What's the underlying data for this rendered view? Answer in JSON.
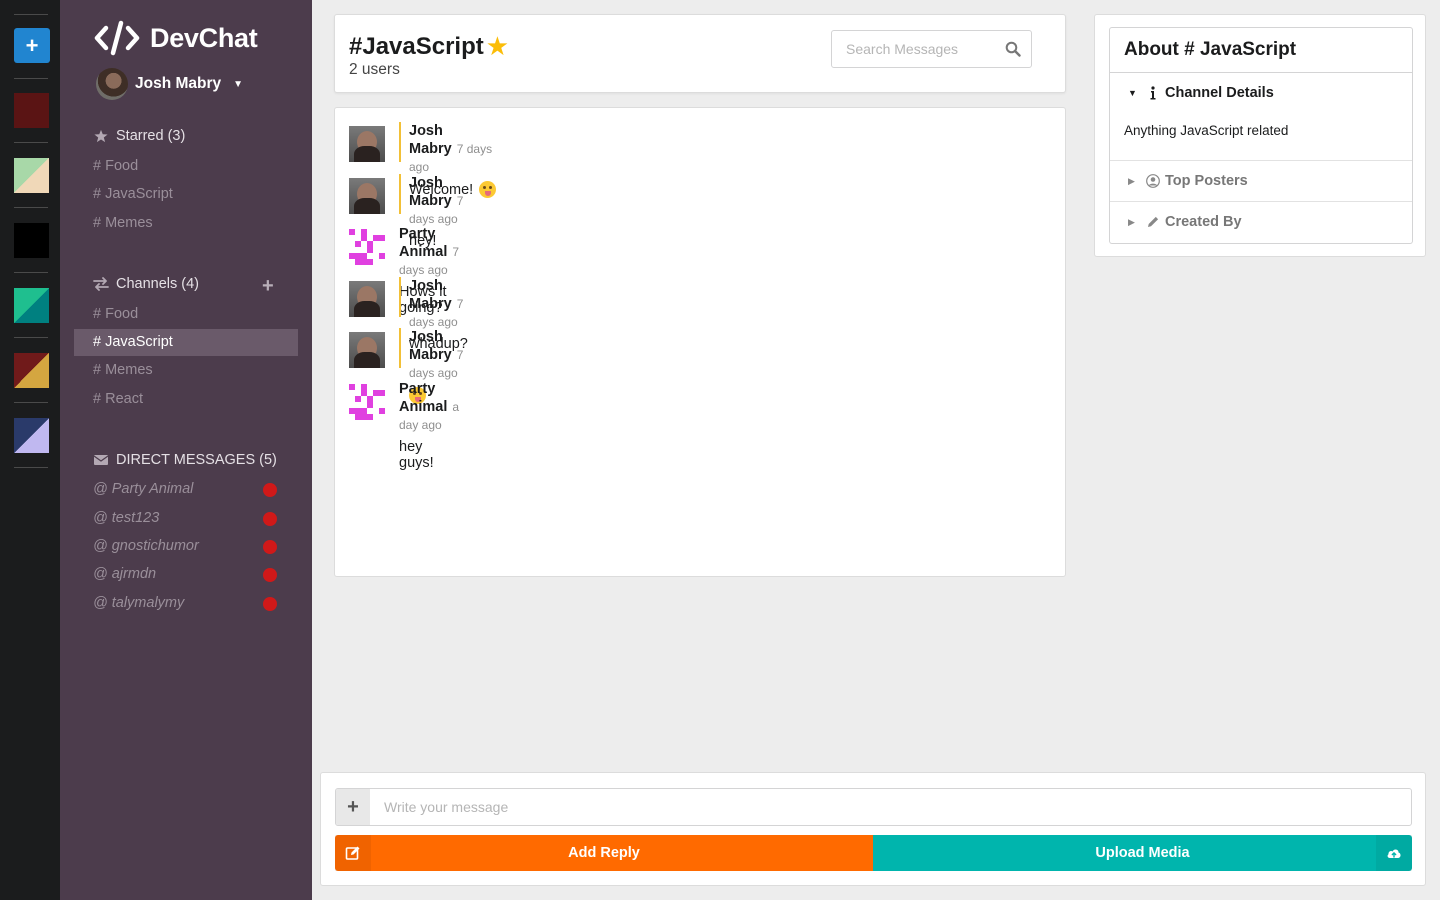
{
  "app": {
    "name": "DevChat"
  },
  "colors": {
    "rail": "#1b1c1d",
    "sidebar": "#4c3c4c",
    "accent_orange": "#ff6a00",
    "accent_teal": "#00b5ad",
    "star": "#fbbd08",
    "notify": "#d01919"
  },
  "rail": {
    "add_icon": "plus-icon",
    "swatches": [
      {
        "primary": "#5a1414",
        "secondary": "#5a1414"
      },
      {
        "primary": "#a8d8a8",
        "secondary": "#f0d8b8"
      },
      {
        "primary": "#000000",
        "secondary": "#000000"
      },
      {
        "primary": "#1fbf8f",
        "secondary": "#008080"
      },
      {
        "primary": "#701a1a",
        "secondary": "#d4a640"
      },
      {
        "primary": "#2a3a6a",
        "secondary": "#c0b8f0"
      }
    ]
  },
  "user": {
    "name": "Josh Mabry"
  },
  "starred": {
    "label": "Starred (3)",
    "items": [
      "# Food",
      "# JavaScript",
      "# Memes"
    ]
  },
  "channels": {
    "label": "Channels (4)",
    "items": [
      "# Food",
      "# JavaScript",
      "# Memes",
      "# React"
    ],
    "active_index": 1
  },
  "direct_messages": {
    "label": "DIRECT MESSAGES (5)",
    "items": [
      "@ Party Animal",
      "@ test123",
      "@ gnostichumor",
      "@ ajrmdn",
      "@ talymalymy"
    ]
  },
  "channel": {
    "title": "#JavaScript",
    "users": "2 users",
    "starred": true
  },
  "search": {
    "placeholder": "Search Messages"
  },
  "messages": [
    {
      "author": "Josh Mabry",
      "time": "7 days ago",
      "text": "Welcome!",
      "emoji": true,
      "own": true
    },
    {
      "author": "Josh Mabry",
      "time": "7 days ago",
      "text": "hey!",
      "emoji": false,
      "own": true
    },
    {
      "author": "Party Animal",
      "time": "7 days ago",
      "text": "Hows it going?",
      "emoji": false,
      "own": false
    },
    {
      "author": "Josh Mabry",
      "time": "7 days ago",
      "text": "whadup?",
      "emoji": false,
      "own": true
    },
    {
      "author": "Josh Mabry",
      "time": "7 days ago",
      "text": "",
      "emoji": true,
      "own": true
    },
    {
      "author": "Party Animal",
      "time": "a day ago",
      "text": "hey guys!",
      "emoji": false,
      "own": false
    }
  ],
  "about": {
    "title": "About # JavaScript",
    "channel_details": "Channel Details",
    "description": "Anything JavaScript related",
    "top_posters": "Top Posters",
    "created_by": "Created By"
  },
  "composer": {
    "placeholder": "Write your message",
    "reply_label": "Add Reply",
    "upload_label": "Upload Media"
  }
}
